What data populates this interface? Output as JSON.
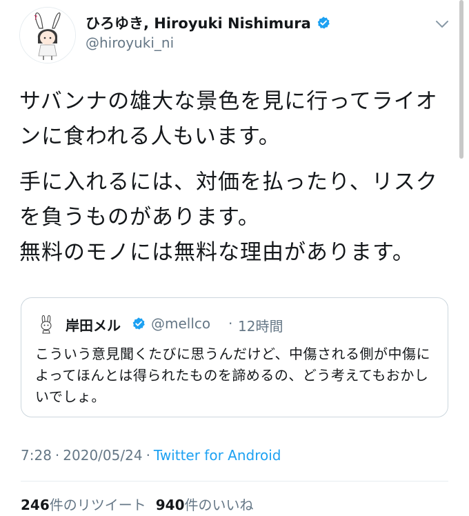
{
  "author": {
    "name": "ひろゆき, Hiroyuki Nishimura",
    "handle": "@hiroyuki_ni"
  },
  "tweet": {
    "paragraphs": [
      "サバンナの雄大な景色を見に行ってライオンに食われる人もいます。",
      "手に入れるには、対価を払ったり、リスクを負うものがあります。\n無料のモノには無料な理由があります。"
    ]
  },
  "quote": {
    "name": "岸田メル",
    "handle": "@mellco",
    "separator": "·",
    "time": "12時間",
    "text": "こういう意見聞くたびに思うんだけど、中傷される側が中傷によってほんとは得られたものを諦めるの、どう考えてもおかしいでしょ。"
  },
  "meta": {
    "time": "7:28",
    "separator1": "·",
    "date": "2020/05/24",
    "separator2": "·",
    "source": "Twitter for Android"
  },
  "stats": {
    "retweets_count": "246",
    "retweets_label": "件のリツイート",
    "likes_count": "940",
    "likes_label": "件のいいね"
  },
  "colors": {
    "accent": "#1da1f2",
    "secondary_text": "#657786",
    "border": "#ccd6dd"
  },
  "icons": {
    "verified": "verified-badge-icon",
    "menu": "chevron-down-icon"
  }
}
